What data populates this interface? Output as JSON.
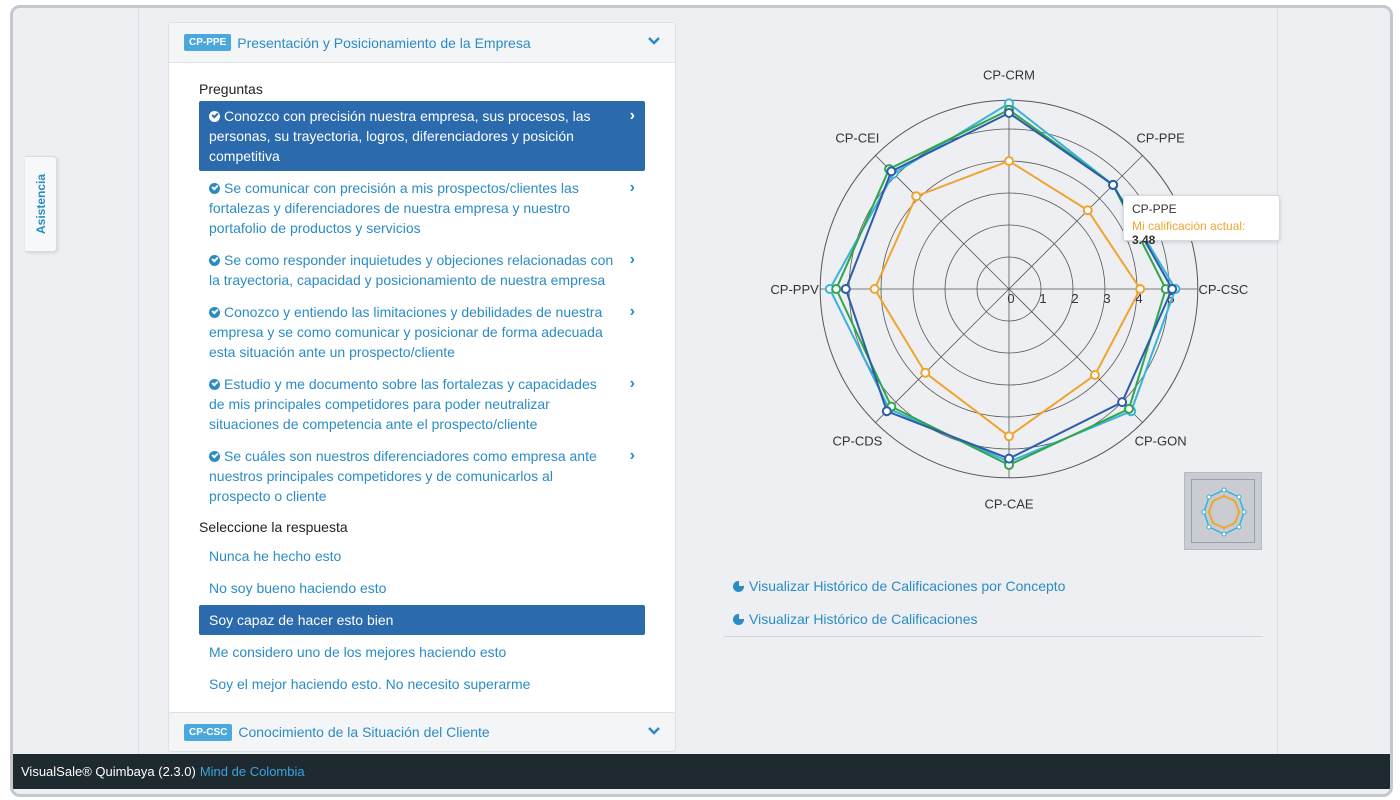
{
  "sidebar": {
    "assist_label": "Asistencia"
  },
  "panel1": {
    "badge": "CP-PPE",
    "title": "Presentación y Posicionamiento de la Empresa",
    "questions_label": "Preguntas",
    "questions": [
      "Conozco con precisión nuestra empresa, sus procesos, las personas, su trayectoria, logros, diferenciadores y posición competitiva",
      "Se comunicar con precisión a mis prospectos/clientes las fortalezas y diferenciadores de nuestra empresa y nuestro portafolio de productos y servicios",
      "Se como responder inquietudes y objeciones relacionadas con la trayectoria, capacidad y posicionamiento de nuestra empresa",
      "Conozco y entiendo las limitaciones y debilidades de nuestra empresa y se como comunicar y posicionar de forma adecuada esta situación ante un prospecto/cliente",
      "Estudio y me documento sobre las fortalezas y capacidades de mis principales competidores para poder neutralizar situaciones de competencia ante el prospecto/cliente",
      "Se cuáles son nuestros diferenciadores como empresa ante nuestros principales competidores y de comunicarlos al prospecto o cliente"
    ],
    "answer_label": "Seleccione la respuesta",
    "answers": [
      "Nunca he hecho esto",
      "No soy bueno haciendo esto",
      "Soy capaz de hacer esto bien",
      "Me considero uno de los mejores haciendo esto",
      "Soy el mejor haciendo esto. No necesito superarme"
    ]
  },
  "panel2": {
    "badge": "CP-CSC",
    "title": "Conocimiento de la Situación del Cliente"
  },
  "tooltip": {
    "name": "CP-PPE",
    "label": "Mi calificación actual:",
    "value": "3.48"
  },
  "links": [
    "Visualizar Histórico de Calificaciones por Concepto",
    "Visualizar Histórico de Calificaciones"
  ],
  "footer": {
    "product": "VisualSale® Quimbaya (2.3.0)",
    "company": "Mind de Colombia"
  },
  "chart_data": {
    "type": "radar",
    "categories": [
      "CP-CRM",
      "CP-PPE",
      "CP-CSC",
      "CP-GON",
      "CP-CAE",
      "CP-CDS",
      "CP-PPV",
      "CP-CEI"
    ],
    "ticks": [
      "0",
      "1",
      "2",
      "3",
      "4",
      "5"
    ],
    "rmax": 5,
    "series": [
      {
        "color": "#f0a430",
        "values": [
          4.0,
          3.48,
          4.1,
          3.8,
          4.6,
          3.7,
          4.2,
          4.1
        ]
      },
      {
        "color": "#2c5da8",
        "values": [
          5.5,
          4.6,
          5.1,
          5.0,
          5.3,
          5.4,
          5.1,
          5.2
        ]
      },
      {
        "color": "#2fa64a",
        "values": [
          5.6,
          4.6,
          4.9,
          5.3,
          5.5,
          5.2,
          5.4,
          5.3
        ]
      },
      {
        "color": "#3ab2d9",
        "values": [
          5.8,
          4.6,
          5.2,
          5.4,
          5.4,
          5.3,
          5.6,
          5.1
        ]
      }
    ]
  }
}
